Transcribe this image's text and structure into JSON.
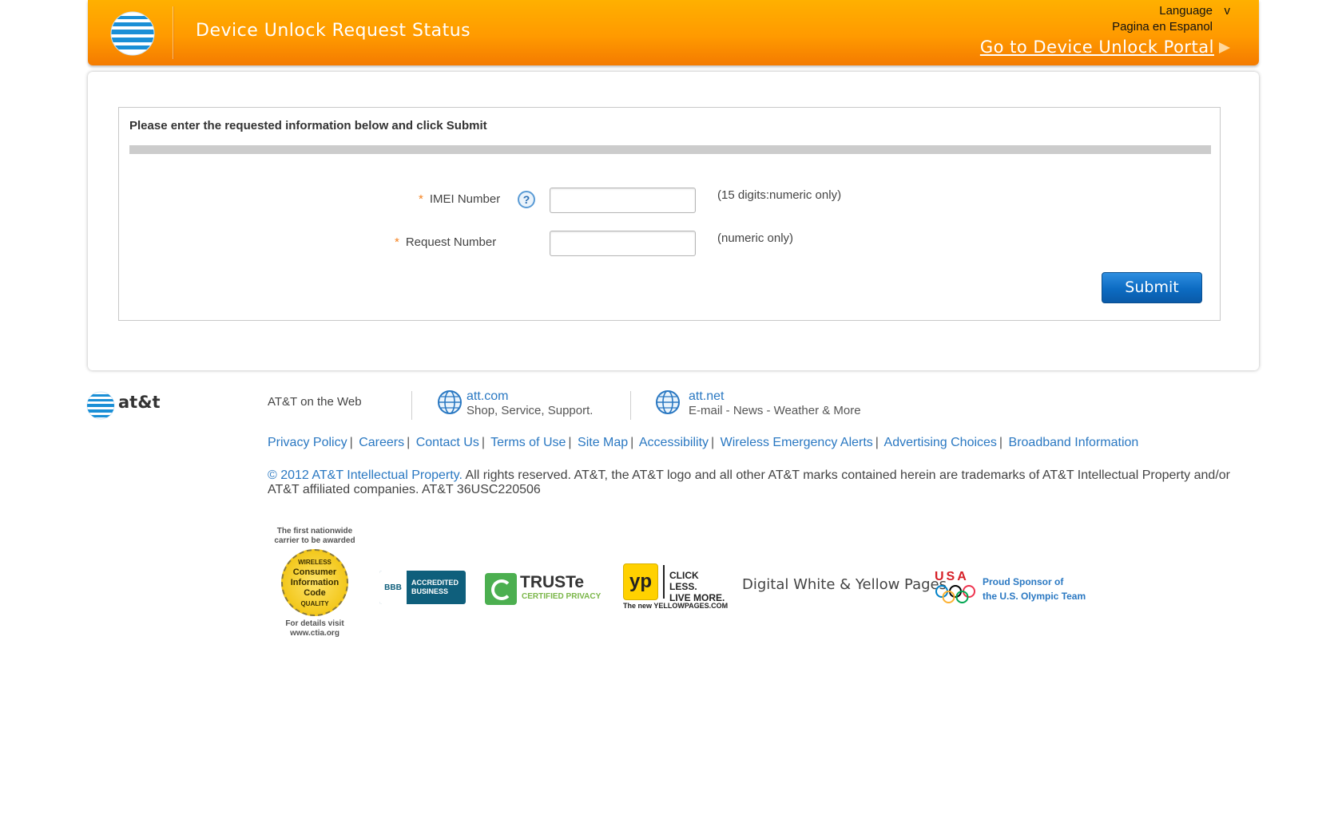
{
  "header": {
    "title": "Device Unlock Request Status",
    "language_label": "Language",
    "language_caret": "v",
    "espanol_link": "Pagina en Espanol",
    "portal_link": "Go to Device Unlock Portal",
    "colors": {
      "bar": "#ff9a00",
      "text": "#ffffff"
    }
  },
  "form": {
    "instructions": "Please enter the requested information below and click Submit",
    "required_marker": "*",
    "fields": [
      {
        "label": "IMEI Number",
        "value": "",
        "hint": "(15 digits:numeric only)",
        "help_icon": "?"
      },
      {
        "label": "Request Number",
        "value": "",
        "hint": "(numeric only)"
      }
    ],
    "submit_label": "Submit",
    "colors": {
      "required": "#f58220",
      "submit": "#0c6bc2"
    }
  },
  "footer": {
    "logo_text": "at&t",
    "web_label": "AT&T on the Web",
    "sites": [
      {
        "title": "att.com",
        "subtitle": "Shop, Service, Support."
      },
      {
        "title": "att.net",
        "subtitle": "E-mail - News - Weather & More"
      }
    ],
    "links": [
      "Privacy Policy",
      "Careers",
      "Contact Us",
      "Terms of Use",
      "Site Map",
      "Accessibility",
      "Wireless Emergency Alerts",
      "Advertising Choices",
      "Broadband Information"
    ],
    "copyright_link": "© 2012 AT&T Intellectual Property.",
    "copyright_text": " All rights reserved. AT&T, the AT&T logo and all other AT&T marks contained herein are trademarks of AT&T Intellectual Property and/or AT&T affiliated companies. AT&T 36USC220506",
    "link_color": "#2a78c2",
    "badges": {
      "ctia": {
        "top": "The first nationwide carrier to be awarded",
        "seal_ring_top": "WIRELESS",
        "seal": [
          "Consumer",
          "Information",
          "Code"
        ],
        "seal_ring_bottom": "QUALITY",
        "bottom": "For details visit www.ctia.org"
      },
      "bbb": {
        "mark": "BBB",
        "text": [
          "ACCREDITED",
          "BUSINESS"
        ]
      },
      "truste": {
        "name": "TRUSTe",
        "sub": "CERTIFIED PRIVACY"
      },
      "yp": {
        "mark": "yp",
        "tag": [
          "CLICK LESS.",
          "LIVE MORE."
        ],
        "bottom": "The new YELLOWPAGES.COM",
        "caption": "Digital White & Yellow Pages"
      },
      "usa": {
        "letters": "USA",
        "text": [
          "Proud Sponsor of",
          "the U.S. Olympic Team"
        ]
      }
    }
  }
}
